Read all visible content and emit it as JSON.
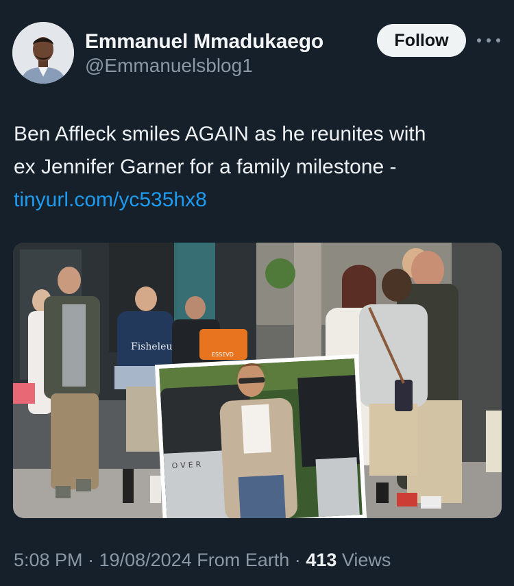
{
  "author": {
    "display_name": "Emmanuel Mmadukaego",
    "handle": "@Emmanuelsblog1",
    "follow_label": "Follow",
    "avatar_icon": "profile-photo-avatar",
    "more_icon": "more-horizontal-icon"
  },
  "tweet": {
    "text_line1": "Ben Affleck smiles AGAIN as he reunites with",
    "text_line2": "ex Jennifer Garner for a family milestone -",
    "link": "tinyurl.com/yc535hx8",
    "link_color": "#1d9bf0"
  },
  "media": {
    "description_icon": "photo-collage-image",
    "tshirt_text": "Fisheleus",
    "bag_text": "ESSEVD",
    "car_text": "OVER"
  },
  "meta": {
    "time": "5:08 PM",
    "separator": "·",
    "date": "19/08/2024",
    "source": "From Earth",
    "views_count": "413",
    "views_label": "Views"
  },
  "colors": {
    "background": "#15202b",
    "primary_text": "#e7e9ea",
    "secondary_text": "#8b98a5",
    "follow_bg": "#eff3f4"
  }
}
